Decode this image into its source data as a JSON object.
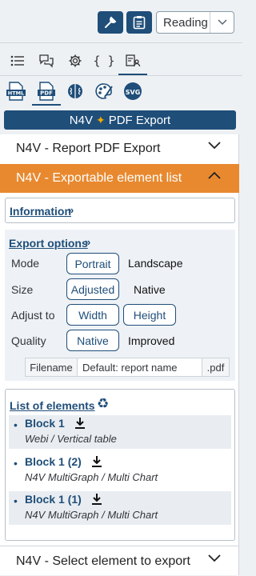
{
  "toolbar": {
    "wrench_icon": "wrench-icon",
    "clipboard_icon": "clipboard-icon",
    "mode_value": "Reading"
  },
  "tabs": [
    "list-icon",
    "comments-icon",
    "gear-icon",
    "code-braces-icon",
    "person-list-icon"
  ],
  "formats": [
    "HTML",
    "PDF",
    "brain-icon",
    "palette-icon",
    "SVG"
  ],
  "title": {
    "left": "N4V",
    "right": "PDF Export"
  },
  "sections": {
    "report": "N4V - Report PDF Export",
    "exportable": "N4V - Exportable element list",
    "select": "N4V - Select element to export"
  },
  "information": {
    "label": "Information"
  },
  "export_options": {
    "label": "Export options",
    "mode": {
      "label": "Mode",
      "options": [
        "Portrait",
        "Landscape"
      ],
      "selected": "Portrait"
    },
    "size": {
      "label": "Size",
      "options": [
        "Adjusted",
        "Native"
      ],
      "selected": "Adjusted"
    },
    "adjust": {
      "label": "Adjust to",
      "options": [
        "Width",
        "Height"
      ]
    },
    "quality": {
      "label": "Quality",
      "options": [
        "Native",
        "Improved"
      ],
      "selected": "Native"
    },
    "filename": {
      "label": "Filename",
      "value": "Default: report name",
      "ext": ".pdf"
    }
  },
  "elements": {
    "label": "List of elements",
    "items": [
      {
        "name": "Block 1",
        "type": "Webi / Vertical table"
      },
      {
        "name": "Block 1 (2)",
        "type": "N4V MultiGraph / Multi Chart"
      },
      {
        "name": "Block 1 (1)",
        "type": "N4V MultiGraph / Multi Chart"
      }
    ]
  },
  "colors": {
    "primary": "#1f4e79",
    "accent": "#e8892f",
    "star": "#f0ab00"
  }
}
